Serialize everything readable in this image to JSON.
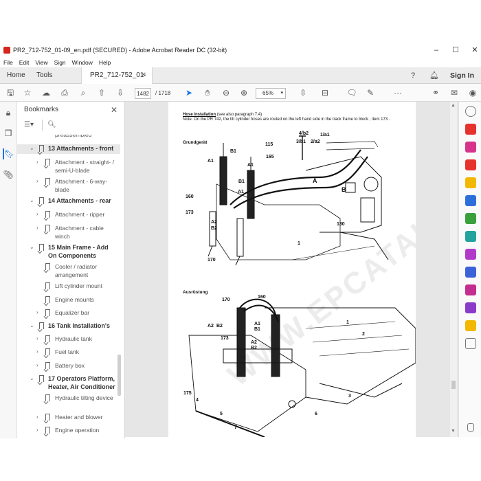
{
  "window": {
    "title": "PR2_712-752_01-09_en.pdf (SECURED) - Adobe Acrobat Reader DC (32-bit)",
    "minimize": "–",
    "maximize": "☐",
    "close": "✕"
  },
  "menu": [
    "File",
    "Edit",
    "View",
    "Sign",
    "Window",
    "Help"
  ],
  "tabs": {
    "home": "Home",
    "tools": "Tools",
    "document": "PR2_712-752_01-0...",
    "document_close": "✕",
    "sign_in": "Sign In"
  },
  "toolbar": {
    "current_page": "1482",
    "total_pages": "/ 1718",
    "zoom": "65%"
  },
  "bookmarks": {
    "title": "Bookmarks",
    "items": [
      {
        "level": "sub",
        "label": "preassembled"
      },
      {
        "level": "top",
        "label": "13 Attachments - front"
      },
      {
        "level": "sub",
        "label": "Attachment - straight- / semi-U-blade"
      },
      {
        "level": "sub",
        "label": "Attachment - 6-way-blade"
      },
      {
        "level": "top",
        "label": "14 Attachments - rear"
      },
      {
        "level": "sub",
        "label": "Attachment - ripper"
      },
      {
        "level": "sub",
        "label": "Attachment - cable winch"
      },
      {
        "level": "top",
        "label": "15 Main Frame - Add On Components"
      },
      {
        "level": "sub",
        "label": "Cooler / radiator arrangement"
      },
      {
        "level": "sub",
        "label": "Lift cylinder mount"
      },
      {
        "level": "sub",
        "label": "Engine mounts"
      },
      {
        "level": "sub",
        "label": "Equalizer bar"
      },
      {
        "level": "top",
        "label": "16 Tank Installation's"
      },
      {
        "level": "sub",
        "label": "Hydraulic tank"
      },
      {
        "level": "sub",
        "label": "Fuel tank"
      },
      {
        "level": "sub",
        "label": "Battery box"
      },
      {
        "level": "top",
        "label": "17 Operators Platform, Heater, Air Conditioner"
      },
      {
        "level": "sub",
        "label": "Hydraulic tilting device"
      },
      {
        "level": "sub",
        "label": "Heater and blower"
      },
      {
        "level": "sub",
        "label": "Engine operation"
      }
    ]
  },
  "document": {
    "heading": "Hose installation",
    "heading_note": "(see also paragraph 7.4)",
    "note": "Note: On the  PR 742, the tilt cylinder hoses are routed on the left hand side in the track frame to block , item 173 .",
    "section1": "Grundgerät",
    "section2": "Ausrüstung",
    "watermark": "WWW.EPCATALOGS.COM",
    "labels1": [
      "A1",
      "B1",
      "A1",
      "B1",
      "A1",
      "160",
      "173",
      "A2",
      "B2",
      "170",
      "115",
      "4/b2",
      "1/a1",
      "3/b1",
      "2/a2",
      "165",
      "A",
      "B",
      "130",
      "1"
    ],
    "labels2": [
      "170",
      "160",
      "A2",
      "B2",
      "173",
      "A2",
      "B2",
      "A1",
      "B1",
      "175",
      "4",
      "5",
      "6",
      "7",
      "1",
      "2",
      "3"
    ]
  }
}
